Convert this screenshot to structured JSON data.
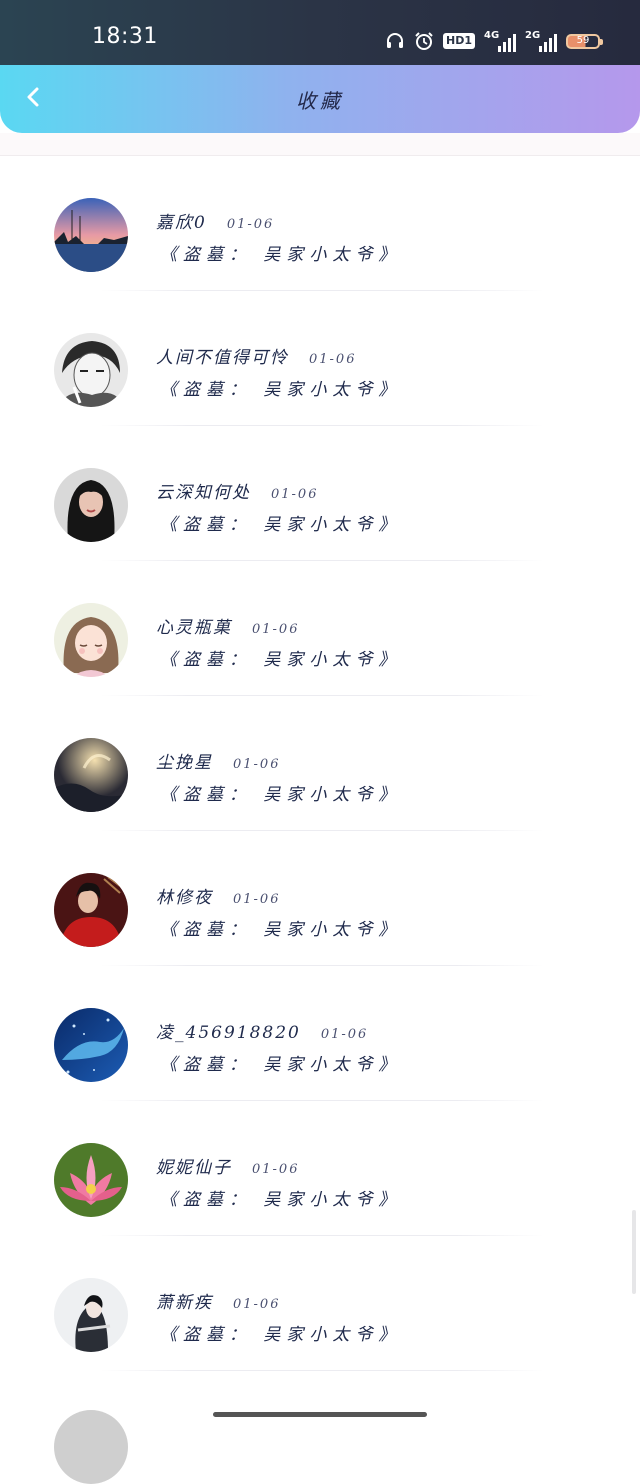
{
  "status_bar": {
    "time": "18:31",
    "icons": [
      "headphones-icon",
      "alarm-icon",
      "hd-icon",
      "signal-4g-icon",
      "signal-2g-icon",
      "battery-icon"
    ],
    "hd_label": "HD1",
    "net1_label": "4G",
    "net2_label": "2G",
    "battery_level": "59"
  },
  "header": {
    "title": "收藏",
    "back_icon": "chevron-left-icon"
  },
  "favorites": [
    {
      "username": "嘉欣0",
      "date": "01-06",
      "work": "《盗墓： 吴家小太爷》",
      "avatar": "sunset-harbor"
    },
    {
      "username": "人间不值得可怜",
      "date": "01-06",
      "work": "《盗墓： 吴家小太爷》",
      "avatar": "sketch-boy"
    },
    {
      "username": "云深知何处",
      "date": "01-06",
      "work": "《盗墓： 吴家小太爷》",
      "avatar": "dark-hair-girl"
    },
    {
      "username": "心灵瓶菓",
      "date": "01-06",
      "work": "《盗墓： 吴家小太爷》",
      "avatar": "cartoon-girl"
    },
    {
      "username": "尘挽星",
      "date": "01-06",
      "work": "《盗墓： 吴家小太爷》",
      "avatar": "night-light"
    },
    {
      "username": "林修夜",
      "date": "01-06",
      "work": "《盗墓： 吴家小太爷》",
      "avatar": "red-robe"
    },
    {
      "username": "凌_456918820",
      "date": "01-06",
      "work": "《盗墓： 吴家小太爷》",
      "avatar": "blue-whale"
    },
    {
      "username": "妮妮仙子",
      "date": "01-06",
      "work": "《盗墓： 吴家小太爷》",
      "avatar": "lotus"
    },
    {
      "username": "萧新疾",
      "date": "01-06",
      "work": "《盗墓： 吴家小太爷》",
      "avatar": "ink-figure"
    }
  ],
  "colors": {
    "header_gradient_start": "#5ad8f2",
    "header_gradient_end": "#b598ec",
    "text_primary": "#1f2a4c",
    "status_bar": "#2b3446"
  }
}
